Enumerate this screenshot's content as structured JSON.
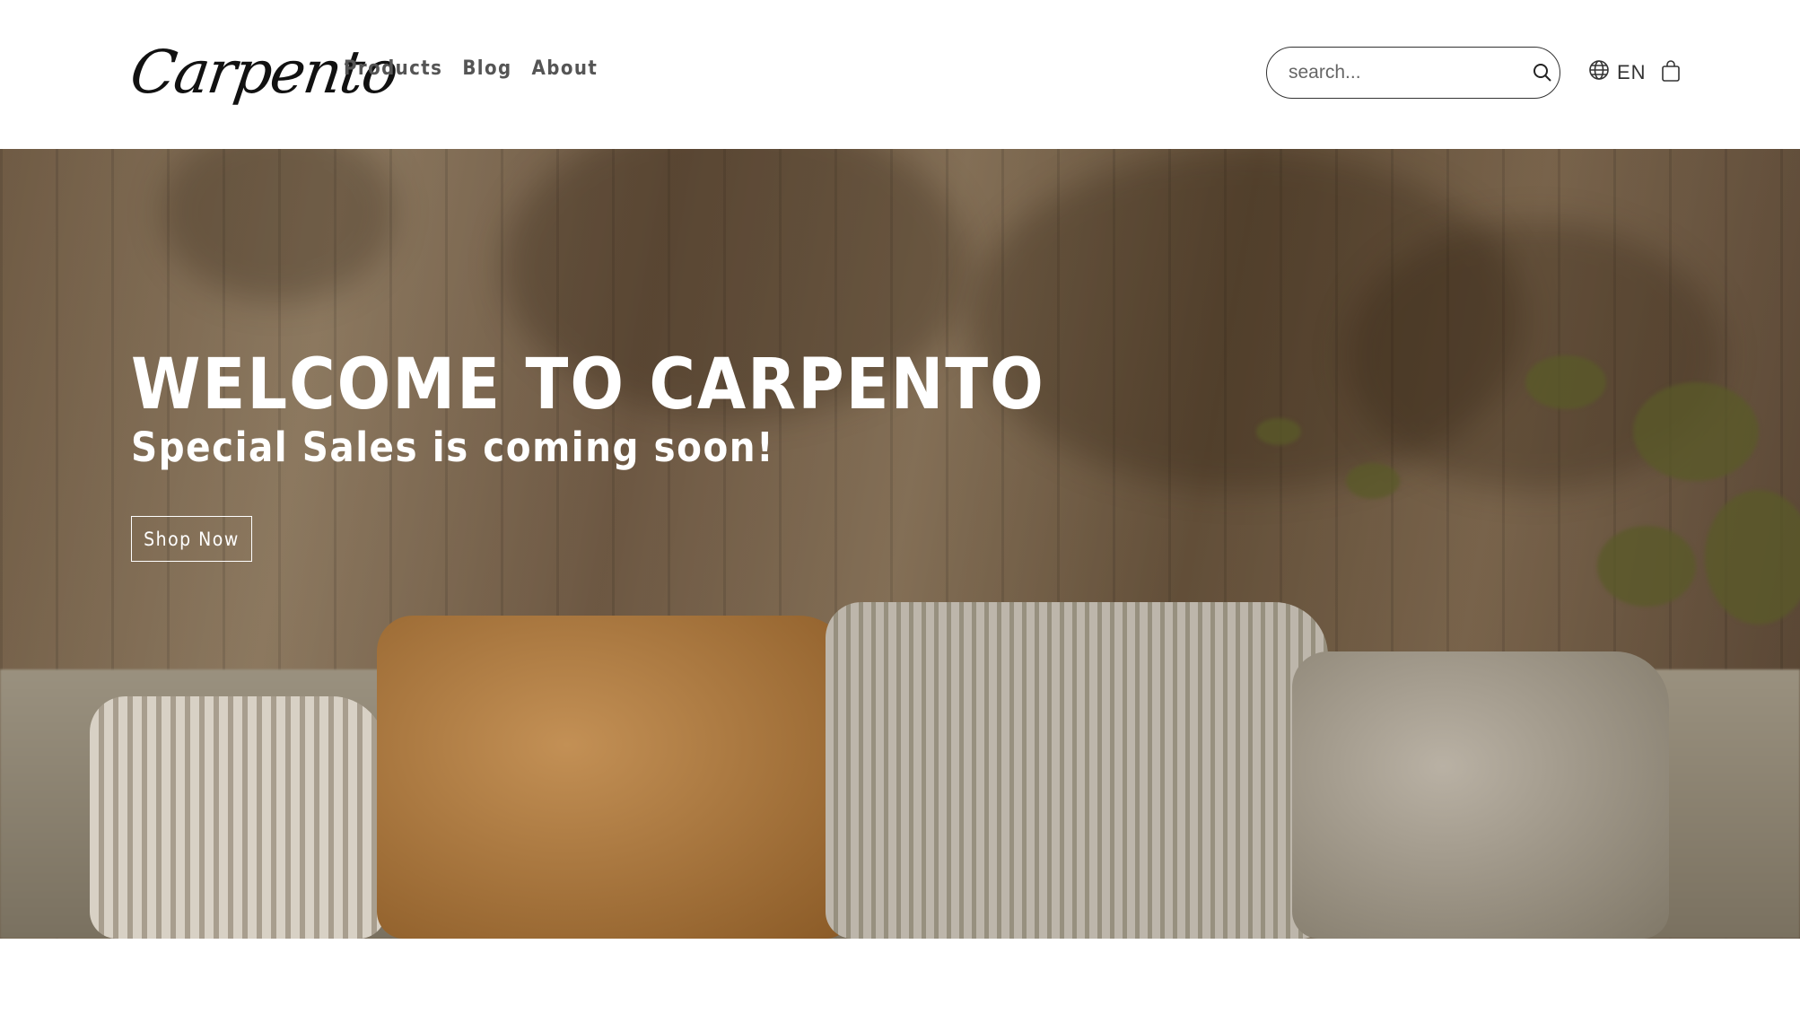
{
  "header": {
    "logo_text": "Carpento",
    "nav": [
      {
        "label": "Products"
      },
      {
        "label": "Blog"
      },
      {
        "label": "About"
      }
    ],
    "search": {
      "placeholder": "search..."
    },
    "language": "EN"
  },
  "hero": {
    "title": "WELCOME TO CARPENTO",
    "subtitle": "Special Sales is coming soon!",
    "cta_label": "Shop Now"
  },
  "icons": {
    "search": "search-icon",
    "language": "globe-icon",
    "cart": "shopping-bag-icon"
  }
}
